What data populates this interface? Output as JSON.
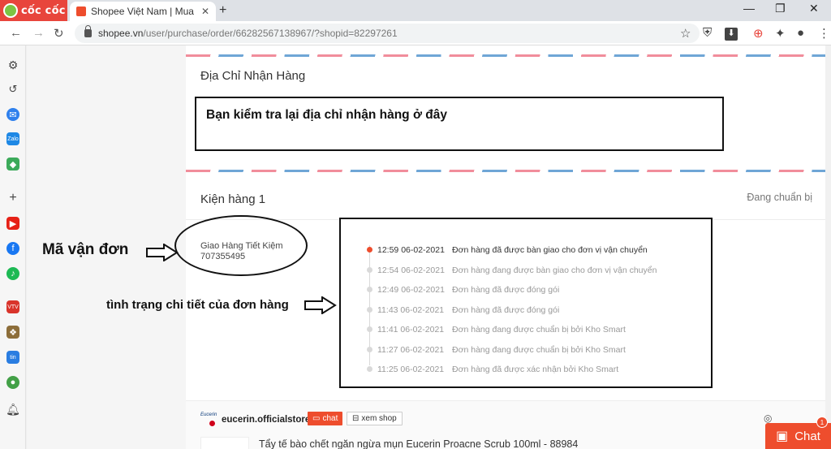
{
  "browser": {
    "brand": "cốc cốc",
    "tab_title": "Shopee Việt Nam | Mua và Bá",
    "url_host": "shopee.vn",
    "url_path": "/user/purchase/order/66282567138967/?shopid=82297261"
  },
  "address_section": {
    "title": "Địa Chỉ Nhận Hàng",
    "callout": "Bạn kiểm tra lại địa chỉ nhận hàng ở đây"
  },
  "package": {
    "title": "Kiện hàng 1",
    "status": "Đang chuẩn bị",
    "carrier": "Giao Hàng Tiết Kiệm",
    "tracking_code": "707355495"
  },
  "annotations": {
    "tracking_label": "Mã vận đơn",
    "detail_label": "tình trạng chi tiết của đơn hàng"
  },
  "timeline": [
    {
      "time": "12:59 06-02-2021",
      "desc": "Đơn hàng đã được bàn giao cho đơn vị vận chuyển"
    },
    {
      "time": "12:54 06-02-2021",
      "desc": "Đơn hàng đang được bàn giao cho đơn vị vận chuyển"
    },
    {
      "time": "12:49 06-02-2021",
      "desc": "Đơn hàng đã được đóng gói"
    },
    {
      "time": "11:43 06-02-2021",
      "desc": "Đơn hàng đã được đóng gói"
    },
    {
      "time": "11:41 06-02-2021",
      "desc": "Đơn hàng đang được chuẩn bị bởi Kho Smart"
    },
    {
      "time": "11:27 06-02-2021",
      "desc": "Đơn hàng đang được chuẩn bị bởi Kho Smart"
    },
    {
      "time": "11:25 06-02-2021",
      "desc": "Đơn hàng đã được xác nhận bởi Kho Smart"
    }
  ],
  "shop": {
    "logo_text": "Eucerin",
    "name": "eucerin.officialstore",
    "chat_label": "chat",
    "view_label": "xem shop",
    "product": "Tẩy tế bào chết ngăn ngừa mụn Eucerin Proacne Scrub 100ml - 88984"
  },
  "chat_widget": {
    "label": "Chat",
    "count": "1"
  },
  "colors": {
    "accent": "#ee4d2d",
    "brand_red": "#e8453c"
  }
}
